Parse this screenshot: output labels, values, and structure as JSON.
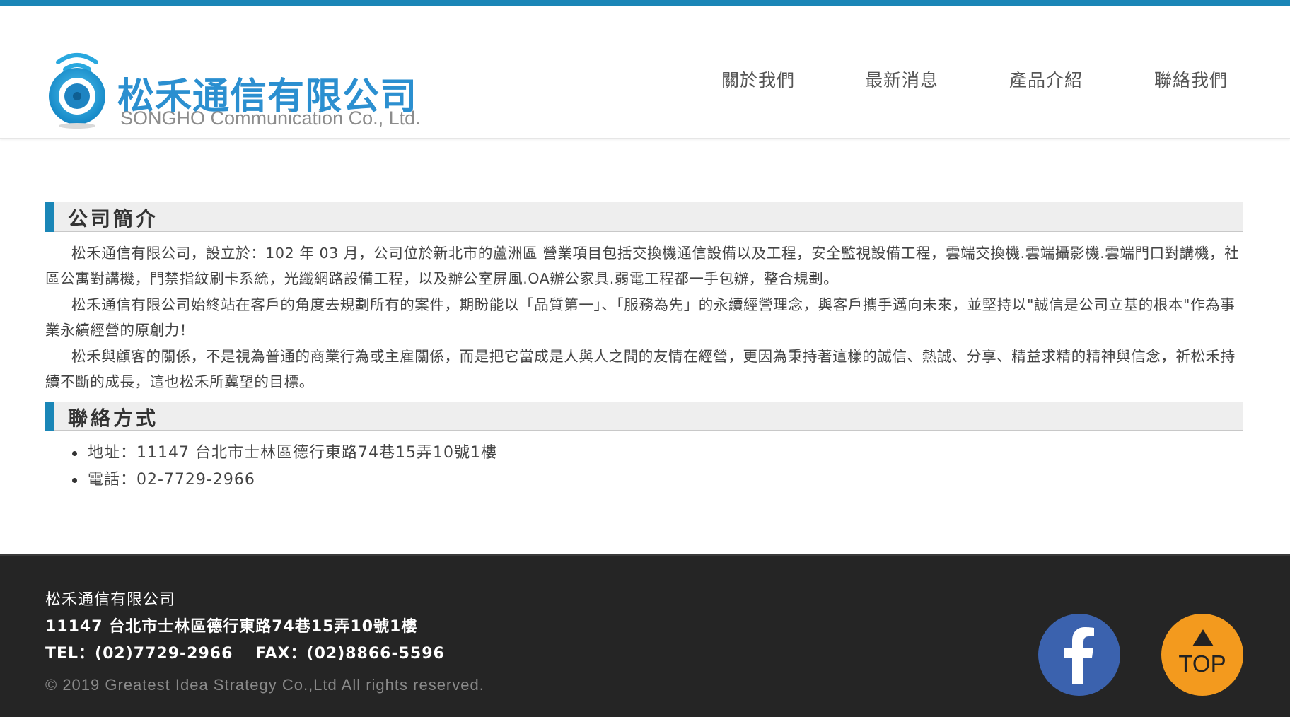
{
  "brand": {
    "name_cn": "松禾通信有限公司",
    "name_en": "SONGHO Communication Co., Ltd.",
    "accent_color": "#1a86b7",
    "logo_icon": "wifi-disc-logo-icon"
  },
  "nav": {
    "items": [
      {
        "label": "關於我們"
      },
      {
        "label": "最新消息"
      },
      {
        "label": "產品介紹"
      },
      {
        "label": "聯絡我們"
      }
    ]
  },
  "about": {
    "title": "公司簡介",
    "paragraphs": [
      "松禾通信有限公司，設立於：102 年 03 月，公司位於新北市的蘆洲區 營業項目包括交換機通信設備以及工程，安全監視設備工程，雲端交換機.雲端攝影機.雲端門口對講機，社區公寓對講機，門禁指紋刷卡系統，光纖網路設備工程，以及辦公室屏風.OA辦公家具.弱電工程都一手包辦，整合規劃。",
      "松禾通信有限公司始終站在客戶的角度去規劃所有的案件，期盼能以「品質第一」、「服務為先」的永續經營理念，與客戶攜手邁向未來，並堅持以\"誠信是公司立基的根本\"作為事業永續經營的原創力！",
      "松禾與顧客的關係，不是視為普通的商業行為或主雇關係，而是把它當成是人與人之間的友情在經營，更因為秉持著這樣的誠信、熱誠、分享、精益求精的精神與信念，祈松禾持續不斷的成長，這也松禾所冀望的目標。"
    ]
  },
  "contact": {
    "title": "聯絡方式",
    "items": [
      {
        "text": "地址：11147 台北市士林區德行東路74巷15弄10號1樓"
      },
      {
        "text": "電話：02-7729-2966"
      }
    ]
  },
  "footer": {
    "company": "松禾通信有限公司",
    "address": "11147 台北市士林區德行東路74巷15弄10號1樓",
    "tel_fax": "TEL：(02)7729-2966　 FAX：(02)8866-5596",
    "copyright": "© 2019 Greatest Idea Strategy Co.,Ltd All rights reserved.",
    "facebook_icon": "facebook-icon",
    "top_label": "TOP",
    "facebook_color": "#3b62ae",
    "top_color": "#f39a1e"
  }
}
